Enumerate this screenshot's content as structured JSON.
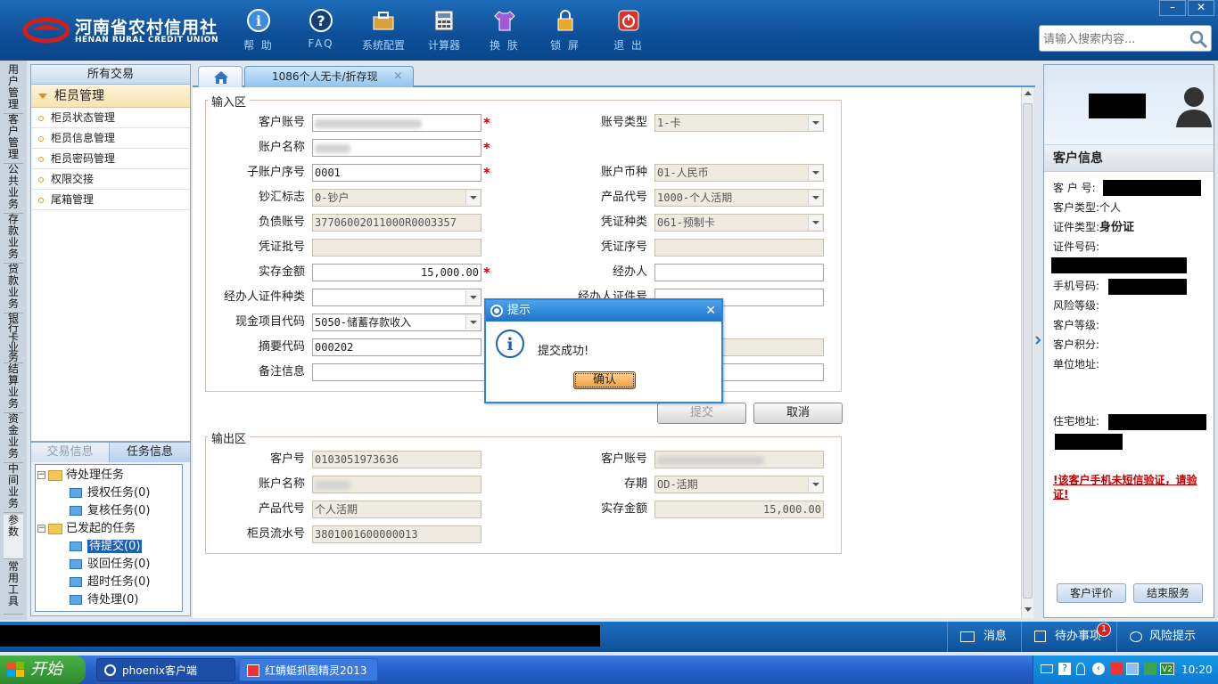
{
  "brand": {
    "name_cn": "河南省农村信用社",
    "name_en": "HENAN RURAL CREDIT UNION"
  },
  "toolbar": [
    {
      "label": "帮 助",
      "icon": "info-icon"
    },
    {
      "label": "FAQ",
      "icon": "faq-icon"
    },
    {
      "label": "系统配置",
      "icon": "toolbox-icon"
    },
    {
      "label": "计算器",
      "icon": "calculator-icon"
    },
    {
      "label": "换 肤",
      "icon": "shirt-icon"
    },
    {
      "label": "锁 屏",
      "icon": "lock-icon"
    },
    {
      "label": "退 出",
      "icon": "power-icon"
    }
  ],
  "window_controls": {
    "minimize": "–",
    "close": "✕"
  },
  "search": {
    "placeholder": "请输入搜索内容..."
  },
  "left_tabs": [
    "用户管理",
    "客户管理",
    "公共业务",
    "存款业务",
    "贷款业务",
    "银行卡业务",
    "结算业务",
    "资金业务",
    "中间业务",
    "参数",
    "常用工具"
  ],
  "nav": {
    "header": "所有交易",
    "group": "柜员管理",
    "items": [
      "柜员状态管理",
      "柜员信息管理",
      "柜员密码管理",
      "权限交接",
      "尾箱管理"
    ]
  },
  "task_panel": {
    "tabs": [
      "交易信息",
      "任务信息"
    ],
    "pending": {
      "label": "待处理任务",
      "children": [
        "授权任务(0)",
        "复核任务(0)"
      ]
    },
    "initiated": {
      "label": "已发起的任务",
      "children": [
        "待提交(0)",
        "驳回任务(0)",
        "超时任务(0)",
        "待处理(0)"
      ]
    }
  },
  "tabs": {
    "active": "1086个人无卡/折存现",
    "close": "×"
  },
  "input_area": {
    "title": "输入区",
    "labels": {
      "customer_account": "客户账号",
      "account_type": "账号类型",
      "account_name": "账户名称",
      "sub_account_no": "子账户序号",
      "currency": "账户币种",
      "cash_flag": "钞汇标志",
      "product_code": "产品代号",
      "liability_account": "负债账号",
      "voucher_type": "凭证种类",
      "voucher_batch": "凭证批号",
      "voucher_seq": "凭证序号",
      "deposit_amount": "实存金额",
      "handler": "经办人",
      "handler_id_type": "经办人证件种类",
      "handler_id_no": "经办人证件号",
      "cash_item_code": "现金项目代码",
      "summary_code": "摘要代码",
      "remarks": "备注信息"
    },
    "values": {
      "account_type": "1-卡",
      "sub_account_no": "0001",
      "currency": "01-人民币",
      "cash_flag": "0-钞户",
      "product_code": "1000-个人活期",
      "liability_account": "37706002011000R0003357",
      "voucher_type": "061-预制卡",
      "deposit_amount": "15,000.00",
      "cash_item_code": "5050-储蓄存款收入",
      "summary_code": "000202"
    },
    "required_mark": "*"
  },
  "buttons": {
    "submit": "提交",
    "cancel": "取消"
  },
  "output_area": {
    "title": "输出区",
    "labels": {
      "customer_no": "客户号",
      "customer_account": "客户账号",
      "account_name": "账户名称",
      "term": "存期",
      "product_code": "产品代号",
      "deposit_amount": "实存金额",
      "teller_serial": "柜员流水号"
    },
    "values": {
      "customer_no": "0103051973636",
      "term": "OD-活期",
      "product_code": "个人活期",
      "deposit_amount": "15,000.00",
      "teller_serial": "3801001600000013"
    }
  },
  "dialog": {
    "title": "提示",
    "message": "提交成功!",
    "ok": "确认",
    "close": "✕"
  },
  "customer_info": {
    "header": "客户信息",
    "labels": {
      "customer_no": "客 户 号:",
      "customer_type": "客户类型:",
      "id_type": "证件类型:",
      "id_no": "证件号码:",
      "mobile": "手机号码:",
      "risk_level": "风险等级:",
      "customer_level": "客户等级:",
      "points": "客户积分:",
      "work_address": "单位地址:",
      "home_address": "住宅地址:"
    },
    "values": {
      "customer_type": "个人",
      "id_type": "身份证"
    },
    "warning": "!该客户手机未短信验证，请验证!",
    "buttons": {
      "evaluate": "客户评价",
      "end": "结束服务"
    }
  },
  "status_bar": {
    "messages": "消息",
    "todo": "待办事项",
    "todo_badge": "1",
    "risk": "风险提示"
  },
  "taskbar": {
    "start": "开始",
    "tasks": [
      "phoenix客户端",
      "红蜻蜓抓图精灵2013"
    ],
    "clock": "10:20"
  },
  "colors": {
    "accent": "#0d4f96",
    "required": "#d10000",
    "warning": "#c00000"
  }
}
